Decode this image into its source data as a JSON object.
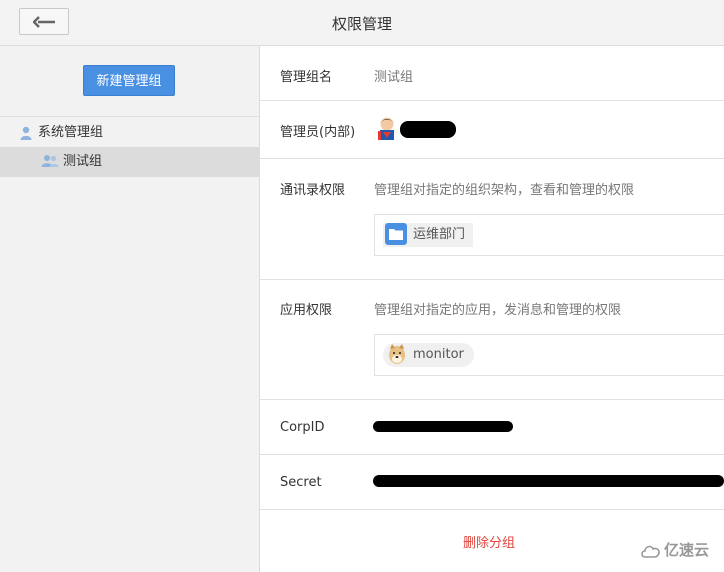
{
  "header": {
    "title": "权限管理"
  },
  "sidebar": {
    "new_group_label": "新建管理组",
    "tree": [
      {
        "label": "系统管理组",
        "icon": "user-icon"
      },
      {
        "label": "测试组",
        "icon": "users-icon",
        "selected": true
      }
    ]
  },
  "form": {
    "group_name": {
      "label": "管理组名",
      "value": "测试组"
    },
    "admin": {
      "label": "管理员(内部)"
    },
    "contacts": {
      "label": "通讯录权限",
      "desc": "管理组对指定的组织架构，查看和管理的权限",
      "items": [
        "运维部门"
      ]
    },
    "apps": {
      "label": "应用权限",
      "desc": "管理组对指定的应用，发消息和管理的权限",
      "items": [
        "monitor"
      ]
    },
    "corpid": {
      "label": "CorpID"
    },
    "secret": {
      "label": "Secret"
    },
    "delete_label": "删除分组"
  },
  "watermark": "亿速云",
  "colors": {
    "accent": "#4a90e2",
    "danger": "#e0443b"
  }
}
